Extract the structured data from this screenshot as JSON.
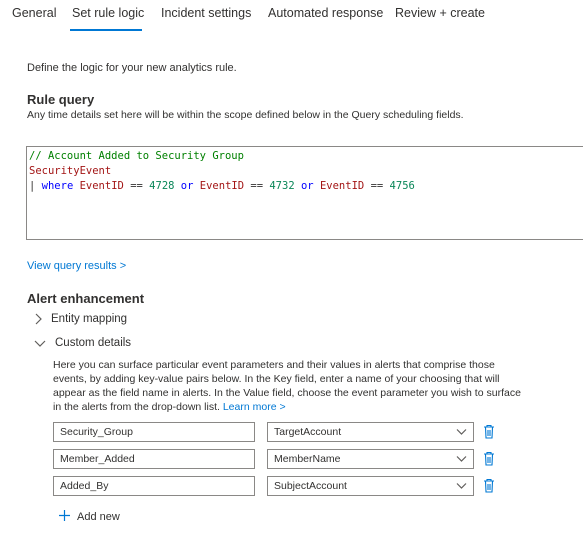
{
  "tabs": [
    {
      "label": "General"
    },
    {
      "label": "Set rule logic"
    },
    {
      "label": "Incident settings"
    },
    {
      "label": "Automated response"
    },
    {
      "label": "Review + create"
    }
  ],
  "active_tab": "Set rule logic",
  "intro": "Define the logic for your new analytics rule.",
  "rule_query": {
    "heading": "Rule query",
    "subtext": "Any time details set here will be within the scope defined below in the Query scheduling fields.",
    "code": {
      "line1": "// Account Added to Security Group",
      "line2": "SecurityEvent",
      "line3_pipe": "| ",
      "where": "where",
      "field1": "EventID",
      "op1": "==",
      "val1": "4728",
      "or1": "or",
      "field2": "EventID",
      "op2": "==",
      "val2": "4732",
      "or2": "or",
      "field3": "EventID",
      "op3": "==",
      "val3": "4756"
    }
  },
  "view_results_link": "View query results >",
  "alert_enhancement": {
    "heading": "Alert enhancement",
    "entity_mapping": "Entity mapping",
    "custom_details": "Custom details",
    "custom_desc": "Here you can surface particular event parameters and their values in alerts that comprise those events, by adding key-value pairs below. In the Key field, enter a name of your choosing that will appear as the field name in alerts. In the Value field, choose the event parameter you wish to surface in the alerts from the drop-down list.",
    "learn_more": "Learn more >",
    "rows": [
      {
        "key": "Security_Group",
        "value": "TargetAccount"
      },
      {
        "key": "Member_Added",
        "value": "MemberName"
      },
      {
        "key": "Added_By",
        "value": "SubjectAccount"
      }
    ],
    "add_new": "Add new"
  },
  "colors": {
    "accent": "#0078d4",
    "comment": "#008000",
    "keyword": "#0000ff",
    "identifier": "#a31515",
    "number": "#098658"
  },
  "icons": [
    "chevron-right-icon",
    "chevron-down-icon",
    "trash-icon",
    "plus-icon"
  ]
}
